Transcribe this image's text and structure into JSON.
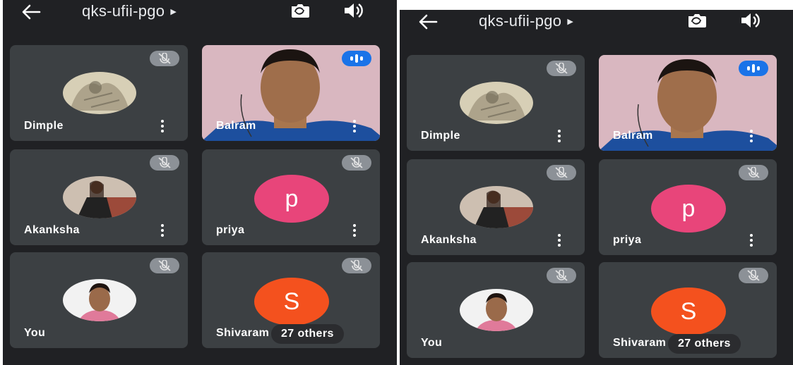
{
  "meeting": {
    "code": "qks-ufii-pgo"
  },
  "tiles": [
    {
      "name": "Dimple",
      "muted": true
    },
    {
      "name": "Balram",
      "speaking": true
    },
    {
      "name": "Akanksha",
      "muted": true
    },
    {
      "name": "priya",
      "letter": "p",
      "color": "#e8457a",
      "muted": true
    },
    {
      "name": "You",
      "muted": true
    },
    {
      "name": "Shivaram",
      "letter": "S",
      "color": "#f4511e",
      "muted": true
    }
  ],
  "others": {
    "label": "27 others"
  },
  "colors": {
    "background": "#202124",
    "tile": "#3c4043",
    "speaking": "#1a73e8"
  }
}
